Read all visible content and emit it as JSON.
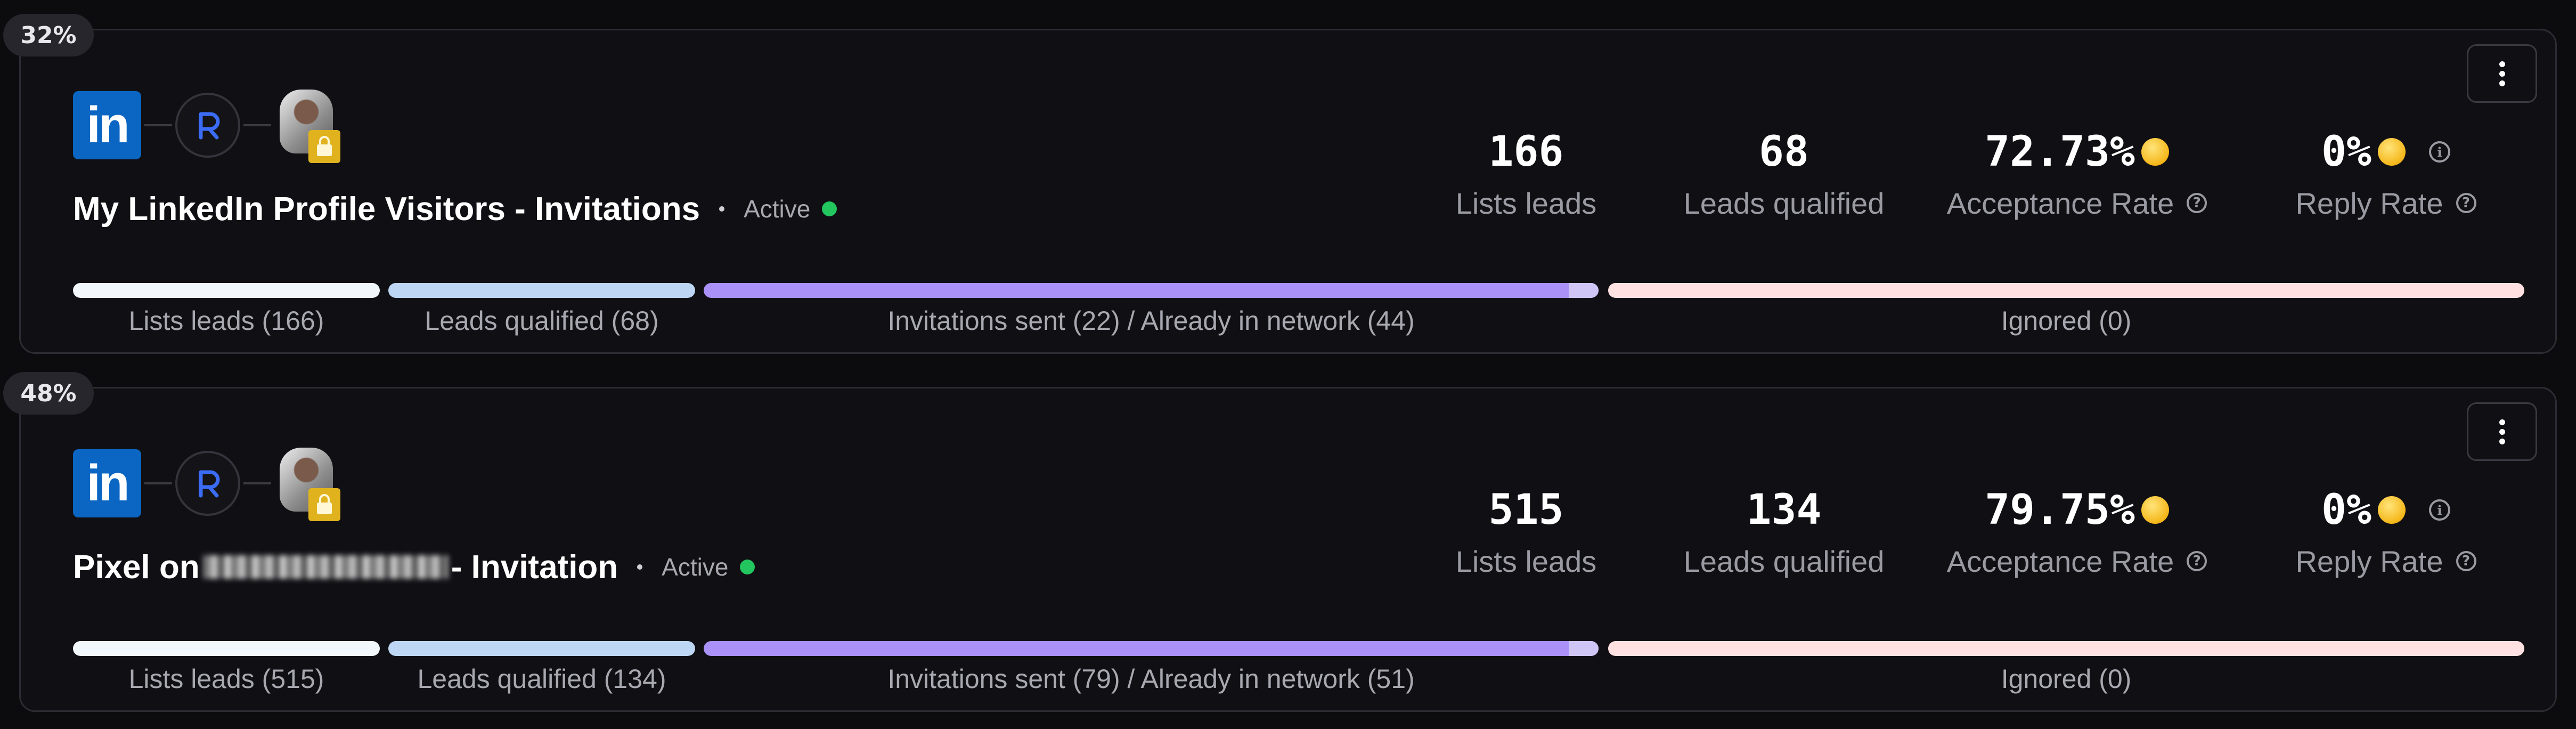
{
  "campaigns": [
    {
      "percent_badge": "32%",
      "title": "My LinkedIn Profile Visitors - Invitations",
      "title_prefix": "",
      "title_suffix": "",
      "status": "Active",
      "icons": {
        "source": "linkedin-icon",
        "tool": "r-logo-icon",
        "owner": "avatar",
        "badge": "lock-icon"
      },
      "stats": {
        "lists_leads": {
          "value": "166",
          "label": "Lists leads"
        },
        "leads_qualified": {
          "value": "68",
          "label": "Leads qualified"
        },
        "acceptance_rate": {
          "value": "72.73%",
          "label": "Acceptance Rate",
          "emoji": "star-struck-emoji"
        },
        "reply_rate": {
          "value": "0%",
          "label": "Reply Rate",
          "emoji": "confused-emoji"
        }
      },
      "progress": {
        "lists_leads": "Lists leads (166)",
        "leads_qualified": "Leads qualified (68)",
        "invitations": "Invitations sent (22) / Already in network (44)",
        "ignored": "Ignored (0)"
      }
    },
    {
      "percent_badge": "48%",
      "title": "",
      "title_prefix": "Pixel on",
      "title_suffix": "- Invitation",
      "status": "Active",
      "icons": {
        "source": "linkedin-icon",
        "tool": "r-logo-icon",
        "owner": "avatar",
        "badge": "lock-icon"
      },
      "stats": {
        "lists_leads": {
          "value": "515",
          "label": "Lists leads"
        },
        "leads_qualified": {
          "value": "134",
          "label": "Leads qualified"
        },
        "acceptance_rate": {
          "value": "79.75%",
          "label": "Acceptance Rate",
          "emoji": "star-struck-emoji"
        },
        "reply_rate": {
          "value": "0%",
          "label": "Reply Rate",
          "emoji": "confused-emoji"
        }
      },
      "progress": {
        "lists_leads": "Lists leads (515)",
        "leads_qualified": "Leads qualified (134)",
        "invitations": "Invitations sent (79) / Already in network (51)",
        "ignored": "Ignored (0)"
      }
    }
  ],
  "brand": {
    "linkedin": "in"
  },
  "colors": {
    "background": "#0c0c0f",
    "card": "#101014",
    "linkedin": "#0a66c2",
    "active": "#22c55e",
    "bar_lists": "#f2f7fc",
    "bar_qualified": "#bcd6f3",
    "bar_invitations": "#a991f8",
    "bar_ignored": "#ffe1e1"
  }
}
